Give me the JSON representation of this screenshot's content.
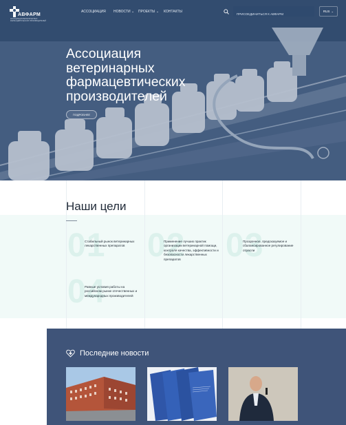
{
  "header": {
    "logo_text": "АВФАРМ",
    "logo_subtitle": "АССОЦИАЦИЯ ВЕТЕРИНАРНЫХ ФАРМАЦЕВТИЧЕСКИХ ПРОИЗВОДИТЕЛЕЙ",
    "nav": [
      "АССОЦИАЦИЯ",
      "НОВОСТИ",
      "ПРОЕКТЫ",
      "КОНТАКТЫ"
    ],
    "search_value": "ПРИСОЕДИНИТЬСЯ К АВФАРМ",
    "lang": "RUS"
  },
  "hero": {
    "title": "Ассоциация ветеринарных фармацевтических производителей",
    "button": "ПОДРОБНЕЕ"
  },
  "goals": {
    "title": "Наши цели",
    "items": [
      {
        "num": "01",
        "text": "Стабильный рынок ветеринарных лекарственных препаратов"
      },
      {
        "num": "02",
        "text": "Применение лучших практик организации ветеринарной помощи, контроля качества, эффективности и безопасности лекарственных препаратов"
      },
      {
        "num": "03",
        "text": "Прозрачное, предсказуемое и сбалансированное регулирование отрасли"
      },
      {
        "num": "04",
        "text": "Равные условия работы на российском рынке отечественных и международных производителей"
      }
    ]
  },
  "news": {
    "title": "Последние новости"
  },
  "colors": {
    "hero_dark": "#3a5579",
    "goals_band": "#f1faf8",
    "goal_number": "#dcf1ec",
    "news_bg": "#3f5479"
  }
}
